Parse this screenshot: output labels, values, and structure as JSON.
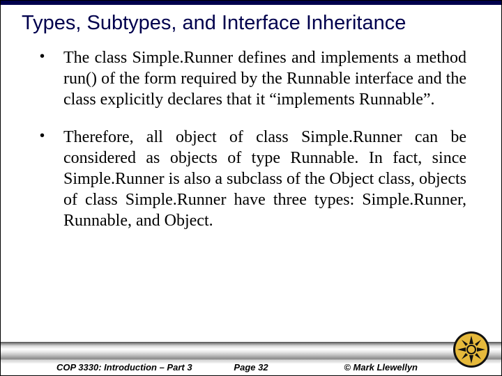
{
  "title": "Types, Subtypes, and Interface Inheritance",
  "bullets": [
    "The class Simple.Runner defines and implements a method run() of the form required by the Runnable interface and the class explicitly declares that it “implements Runnable”.",
    "Therefore, all object of class Simple.Runner can be considered as objects of type Runnable.  In fact, since Simple.Runner is also a subclass of the Object class, objects of class Simple.Runner have three types: Simple.Runner, Runnable, and Object."
  ],
  "footer": {
    "left": "COP 3330:  Introduction – Part 3",
    "center": "Page 32",
    "right": "© Mark Llewellyn"
  }
}
